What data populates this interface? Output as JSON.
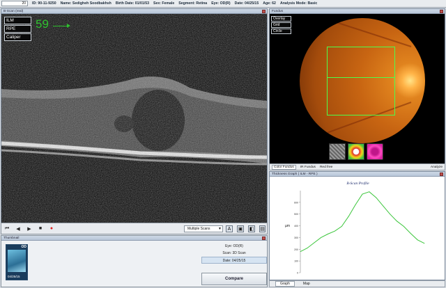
{
  "topbar": {
    "slice_number": "20",
    "id": "ID: 90-11-9250",
    "name": "Name: Sedigheh Soodbakhsh",
    "birth": "Birth Date: 01/01/53",
    "sex": "Sex: Female",
    "segment": "Segment: Retina",
    "eye": "Eye: OD(R)",
    "date": "Date: 04/25/15",
    "age": "Age: 62",
    "analysis": "Analysis Mode: Basic"
  },
  "bscan": {
    "panel_title": "B-Scan (real)",
    "layers": [
      "ILM",
      "RPE",
      "Caliper"
    ],
    "frame_number": "59",
    "multi_scans_label": "Multiple Scans"
  },
  "fundus": {
    "panel_title": "Fundus",
    "options": [
      "Overlay",
      "Grid",
      "Circle"
    ],
    "tabs": [
      "Color Fundus",
      "IR Fundus",
      "Red free"
    ],
    "analyze_label": "Analyze"
  },
  "thumbnails": {
    "panel_title": "Thumbnail",
    "card_eye": "OD",
    "card_date": "04/25/15",
    "eye_line": "Eye: OD(R)",
    "scan_line": "Scan: 3D Scan",
    "date_line": "Date: 04/25/15",
    "compare_label": "Compare"
  },
  "graph": {
    "panel_title": "Thickness Graph ( ILM - RPE )",
    "title": "B-Scan Profile",
    "ylabel": "µm",
    "yticks": [
      "0",
      "100",
      "200",
      "300",
      "400",
      "500",
      "600"
    ],
    "tabs": [
      "Graph",
      "Map"
    ]
  },
  "chart_data": {
    "type": "line",
    "title": "B-Scan Profile",
    "ylabel": "µm",
    "ylim": [
      0,
      700
    ],
    "yticks": [
      0,
      100,
      200,
      300,
      400,
      500,
      600
    ],
    "x": [
      0,
      10,
      20,
      30,
      40,
      50,
      60,
      70,
      80,
      90,
      100,
      110,
      120,
      130,
      140,
      150,
      160,
      170,
      180
    ],
    "series": [
      {
        "values": [
          180,
          210,
          255,
          300,
          330,
          355,
          395,
          480,
          580,
          670,
          690,
          640,
          570,
          500,
          440,
          395,
          335,
          280,
          250
        ]
      }
    ]
  },
  "colors": {
    "green_text": "#2fc12f",
    "scan_rect": "#4cff4c",
    "graph_line": "#3cc63c"
  }
}
